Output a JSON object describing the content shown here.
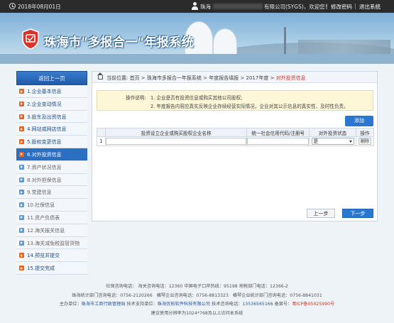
{
  "topbar": {
    "date": "2018年08月01日",
    "user_name": "珠海",
    "company": "有限公司(SYGS)，欢迎您！",
    "change_password": "修改密码",
    "logout": "退出系统",
    "separator": "|"
  },
  "header": {
    "title": "珠海市\"多报合一\"年报系统"
  },
  "sidebar": {
    "back_label": "返回上一页",
    "items": [
      {
        "label": "1.企业基本信息",
        "state": "done"
      },
      {
        "label": "2.企业变动情况",
        "state": "done"
      },
      {
        "label": "3.股东及出资信息",
        "state": "done"
      },
      {
        "label": "4.网站或网店信息",
        "state": "done"
      },
      {
        "label": "5.股权变更信息",
        "state": "done"
      },
      {
        "label": "6.对外投资信息",
        "state": "active"
      },
      {
        "label": "7.资产状况信息",
        "state": "todo"
      },
      {
        "label": "8.对外担保信息",
        "state": "todo"
      },
      {
        "label": "9.党建信息",
        "state": "todo"
      },
      {
        "label": "10.社保信息",
        "state": "todo"
      },
      {
        "label": "11.资产负债表",
        "state": "todo"
      },
      {
        "label": "12.海关报关信息",
        "state": "todo"
      },
      {
        "label": "13.海关减免税监管货物",
        "state": "todo"
      },
      {
        "label": "14.预览并提交",
        "state": "done"
      },
      {
        "label": "15.提交完成",
        "state": "done"
      }
    ]
  },
  "breadcrumb": {
    "prefix": "当前位置: 首页 > 珠海市多报合一年报系统 > 年度报告填报 > 2017年度 > ",
    "current": "对外投资信息"
  },
  "notice": {
    "label": "操作说明:",
    "line1": "1. 企业是否有投资信息或购买其他公司股权;",
    "line2": "2. 年度报告内容应真实反映企业存续经营实际情况，企业对其公示信息的真实性、及时性负责。"
  },
  "table": {
    "add_label": "添加",
    "headers": [
      "",
      "投资设立企业或购买股权企业名称",
      "统一社会信用代码/注册号",
      "对外投资状态",
      "操作"
    ],
    "rows": [
      {
        "index": "1",
        "name": "",
        "code": "",
        "status": "是",
        "action": "删除"
      }
    ]
  },
  "actions": {
    "prev": "上一步",
    "next": "下一步"
  },
  "footer": {
    "line1": "社保咨询电话： 海关咨询电话：12360 中国电子口岸热线：95198 地税部门电话：12366-2",
    "line2": "珠海统计部门咨询电话：0756-2120266 ⁣ ⁣ 横琴企业咨询电话：0756-8813323 ⁣ ⁣ 横琴企业统计部门咨询电话：0756-8841031",
    "line3_a": "主办单位：",
    "line3_b": "珠海市工商行政管理局",
    "line3_c": " 技术支持单位：",
    "line3_d": "珠海优拓软件科技有限公司",
    "line3_e": " 技术咨询电话：",
    "line3_f": "13536565166",
    "line3_g": " 备案号：",
    "line3_h": "粤ICP备05025990号",
    "line4": "建议使用分辨率为1024*768及以上访问本系统"
  }
}
